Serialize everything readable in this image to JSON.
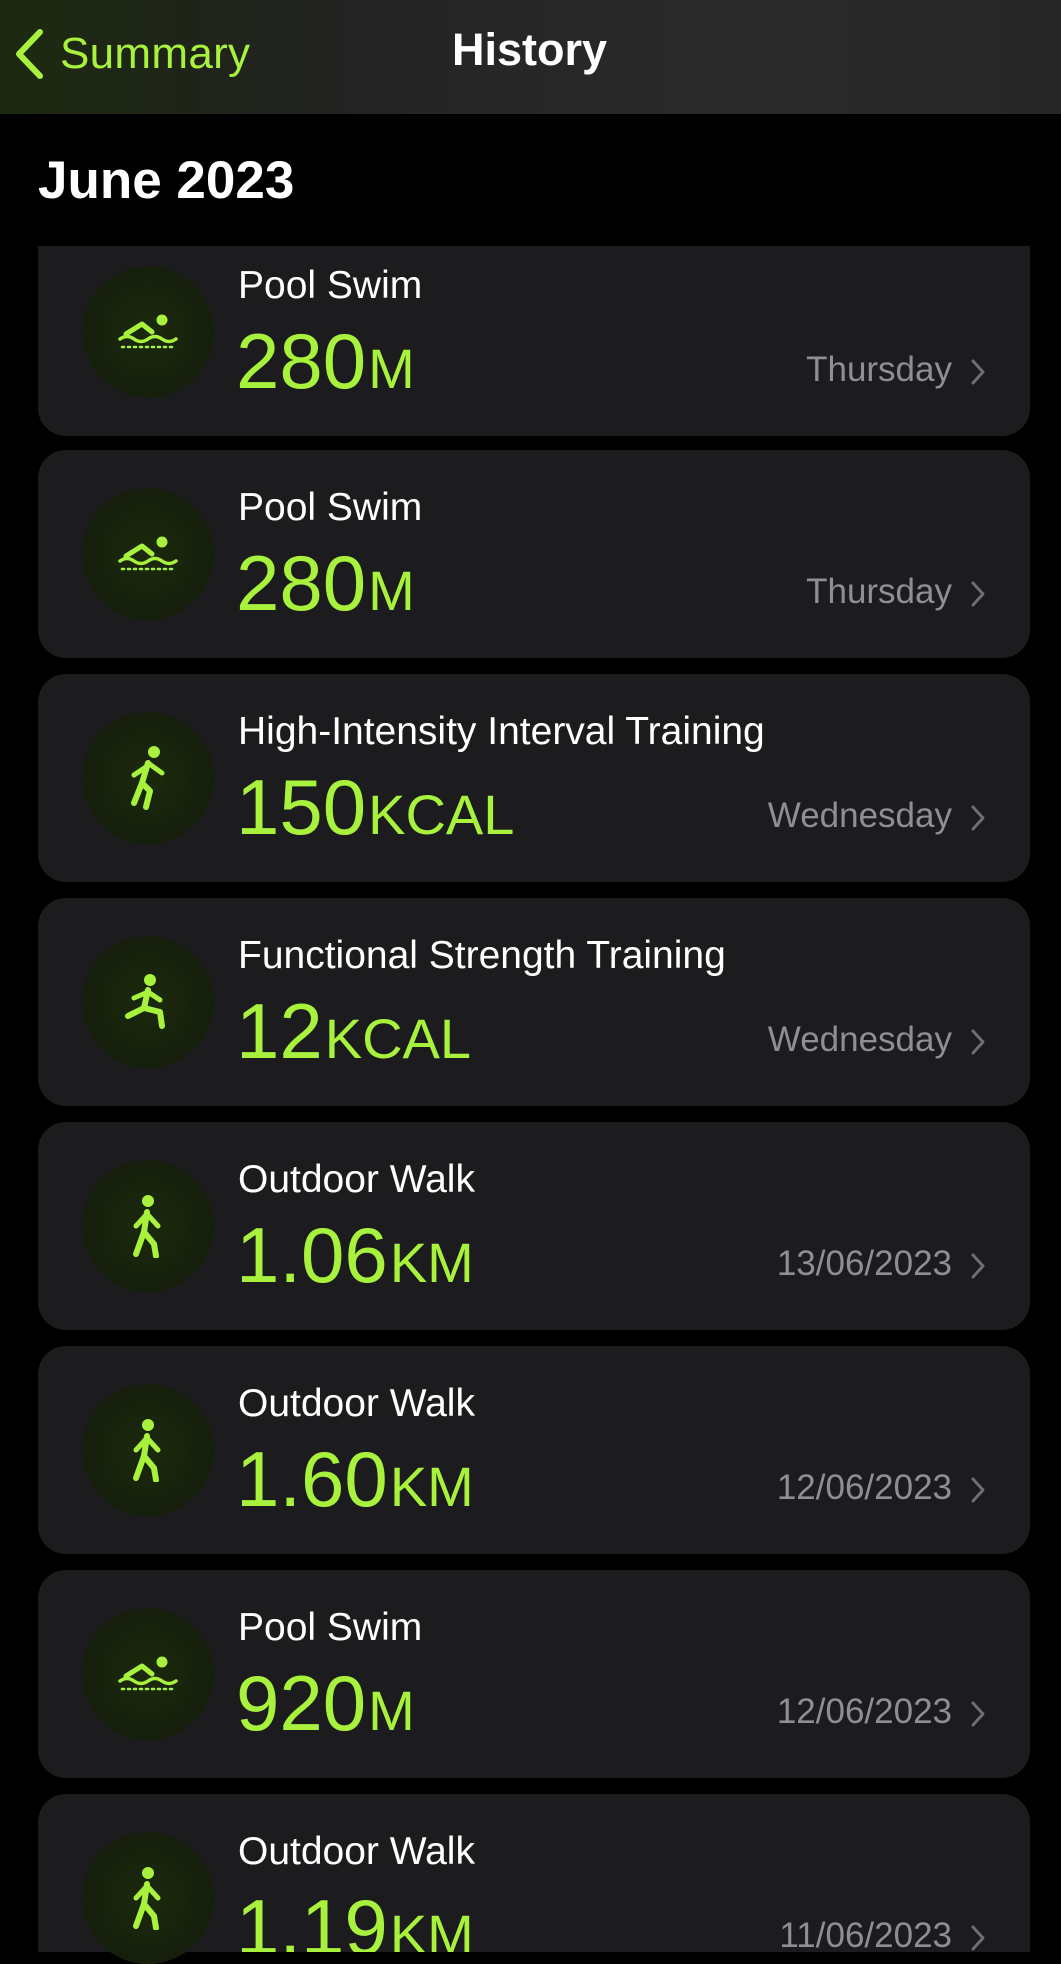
{
  "nav": {
    "back_label": "Summary",
    "title": "History"
  },
  "section_title": "June 2023",
  "colors": {
    "accent": "#a8f23d",
    "card": "#1c1c1e",
    "secondary_text": "#8e8e93"
  },
  "workouts": [
    {
      "name": "Pool Swim",
      "value": "280",
      "unit": "M",
      "date": "Thursday",
      "icon": "swim-icon"
    },
    {
      "name": "Pool Swim",
      "value": "280",
      "unit": "M",
      "date": "Thursday",
      "icon": "swim-icon"
    },
    {
      "name": "High-Intensity Interval Training",
      "value": "150",
      "unit": "KCAL",
      "date": "Wednesday",
      "icon": "hiit-icon"
    },
    {
      "name": "Functional Strength Training",
      "value": "12",
      "unit": "KCAL",
      "date": "Wednesday",
      "icon": "strength-training-icon"
    },
    {
      "name": "Outdoor Walk",
      "value": "1.06",
      "unit": "KM",
      "date": "13/06/2023",
      "icon": "walk-icon"
    },
    {
      "name": "Outdoor Walk",
      "value": "1.60",
      "unit": "KM",
      "date": "12/06/2023",
      "icon": "walk-icon"
    },
    {
      "name": "Pool Swim",
      "value": "920",
      "unit": "M",
      "date": "12/06/2023",
      "icon": "swim-icon"
    },
    {
      "name": "Outdoor Walk",
      "value": "1.19",
      "unit": "KM",
      "date": "11/06/2023",
      "icon": "walk-icon"
    }
  ]
}
